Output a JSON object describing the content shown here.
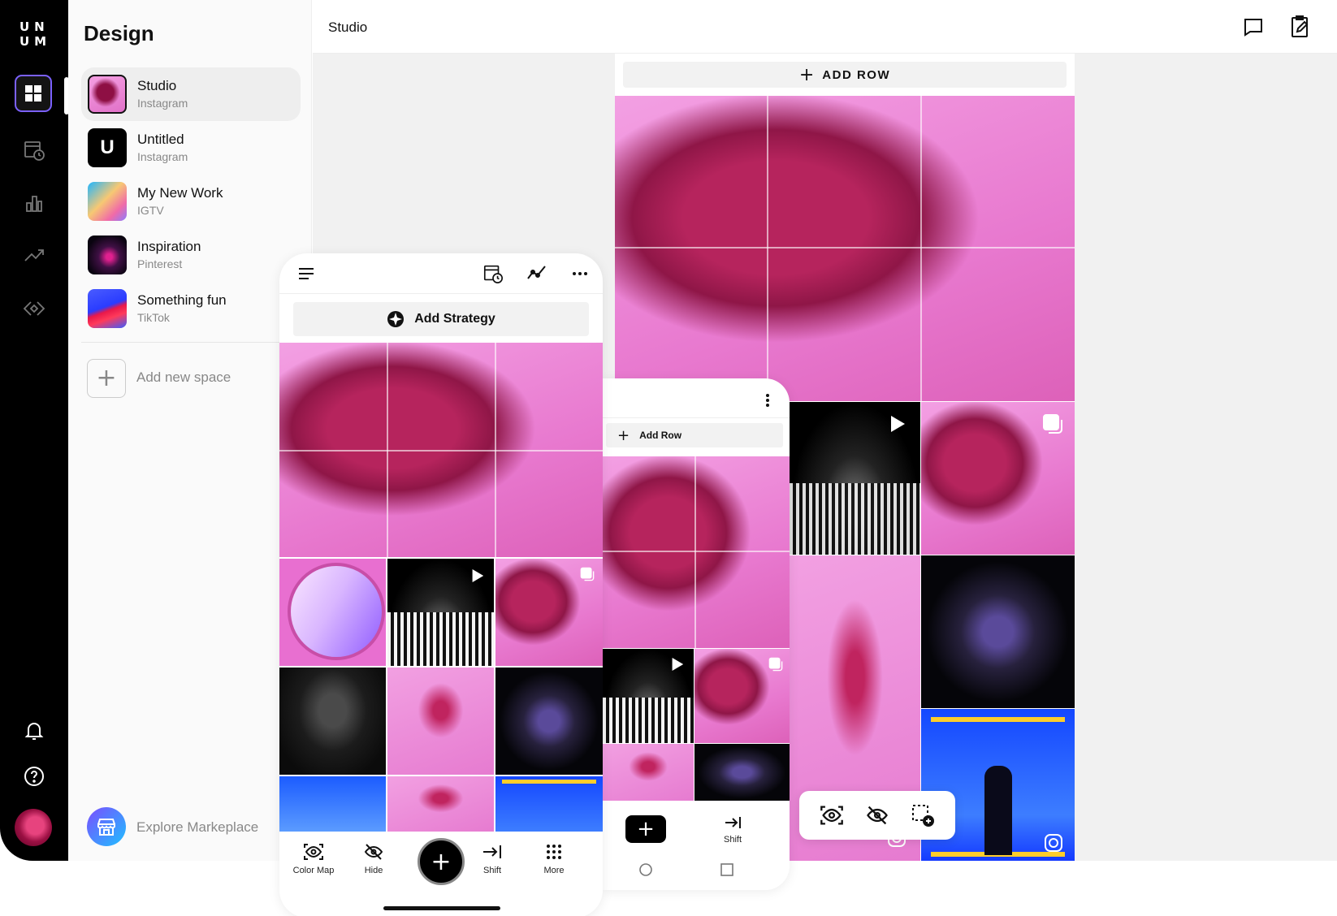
{
  "app": {
    "logo_top": "UN",
    "logo_bottom": "UM"
  },
  "sidebar": {
    "title": "Design",
    "spaces": [
      {
        "name": "Studio",
        "type": "Instagram",
        "thumb": "portrait"
      },
      {
        "name": "Untitled",
        "type": "Instagram",
        "thumb": "letter",
        "letter": "U"
      },
      {
        "name": "My New Work",
        "type": "IGTV",
        "thumb": "gradient"
      },
      {
        "name": "Inspiration",
        "type": "Pinterest",
        "thumb": "dark"
      },
      {
        "name": "Something fun",
        "type": "TikTok",
        "thumb": "blue"
      }
    ],
    "add_space_label": "Add new space",
    "explore_label": "Explore Markeplace"
  },
  "topbar": {
    "title": "Studio",
    "icons": [
      "comment-icon",
      "edit-clipboard-icon"
    ]
  },
  "big_panel": {
    "add_row_label": "ADD ROW"
  },
  "phone": {
    "add_strategy_label": "Add Strategy",
    "bottom": [
      {
        "label": "Color Map",
        "icon": "eye-scan-icon"
      },
      {
        "label": "Hide",
        "icon": "eye-off-icon"
      },
      {
        "label": "Shift",
        "icon": "shift-right-icon"
      },
      {
        "label": "More",
        "icon": "grid-dots-icon"
      }
    ]
  },
  "mid_phone": {
    "add_row_label": "Add Row",
    "shift_label": "Shift"
  },
  "float_toolbar": {
    "icons": [
      "eye-scan-icon",
      "eye-off-icon",
      "add-selection-icon"
    ]
  },
  "colors": {
    "accent": "#7b61ff",
    "rail": "#000000",
    "pink": "#ea74cf"
  }
}
